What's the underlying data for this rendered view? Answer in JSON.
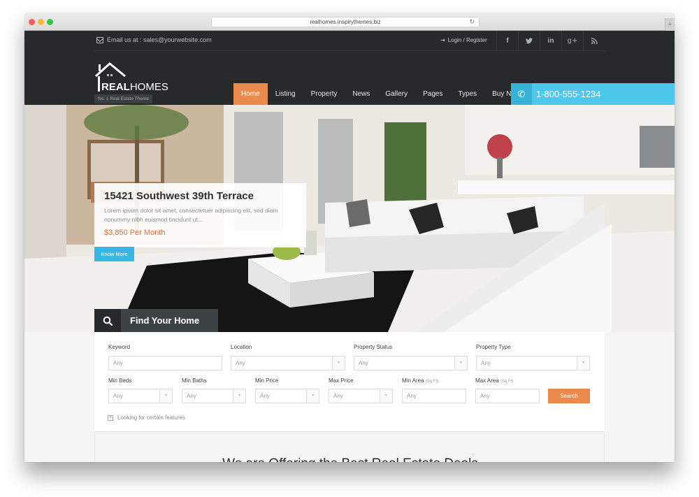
{
  "browser": {
    "url": "realhomes.inspirythemes.biz",
    "reload_icon": "↻",
    "new_tab_icon": "+"
  },
  "topbar": {
    "email_text": "Email us at : sales@yourwebsite.com",
    "login_text": "Login / Register",
    "login_icon": "⇥",
    "socials": [
      {
        "name": "facebook",
        "glyph": "f"
      },
      {
        "name": "twitter",
        "glyph": "t"
      },
      {
        "name": "linkedin",
        "glyph": "in"
      },
      {
        "name": "google-plus",
        "glyph": "g+"
      },
      {
        "name": "rss",
        "glyph": "≡"
      }
    ]
  },
  "logo": {
    "bold": "REAL",
    "light": "HOMES",
    "tagline": "No. 1 Real Estate Theme"
  },
  "nav": {
    "items": [
      {
        "label": "Home",
        "active": true
      },
      {
        "label": "Listing",
        "active": false
      },
      {
        "label": "Property",
        "active": false
      },
      {
        "label": "News",
        "active": false
      },
      {
        "label": "Gallery",
        "active": false
      },
      {
        "label": "Pages",
        "active": false
      },
      {
        "label": "Types",
        "active": false
      },
      {
        "label": "Buy Now",
        "active": false
      }
    ],
    "phone": "1-800-555-1234",
    "phone_icon": "✆"
  },
  "slide": {
    "title": "15421 Southwest 39th Terrace",
    "description": "Lorem ipsum dolor sit amet, consectetuer adipiscing elit, sed diam nonummy nibh euismod tincidunt ut…",
    "price": "$3,850 Per Month",
    "cta": "Know More"
  },
  "search": {
    "tab_label": "Find Your Home",
    "fields": {
      "keyword": {
        "label": "Keyword",
        "placeholder": "Any"
      },
      "location": {
        "label": "Location",
        "value": "Any"
      },
      "status": {
        "label": "Property Status",
        "value": "Any"
      },
      "type": {
        "label": "Property Type",
        "value": "Any"
      },
      "min_beds": {
        "label": "Min Beds",
        "value": "Any"
      },
      "min_baths": {
        "label": "Min Baths",
        "value": "Any"
      },
      "min_price": {
        "label": "Min Price",
        "value": "Any"
      },
      "max_price": {
        "label": "Max Price",
        "value": "Any"
      },
      "min_area": {
        "label": "Min Area",
        "unit": "(Sq Ft)",
        "placeholder": "Any"
      },
      "max_area": {
        "label": "Max Area",
        "unit": "(Sq Ft)",
        "placeholder": "Any"
      }
    },
    "dropdown_arrow": "▾",
    "submit_label": "Search",
    "features_label": "Looking for certain features",
    "features_icon": "+"
  },
  "section": {
    "title": "We are Offering the Best Real Estate Deals"
  },
  "colors": {
    "accent_orange": "#ec894d",
    "accent_blue": "#4dc7ec",
    "header_dark": "#262a2b",
    "price_orange": "#df6c2d"
  }
}
